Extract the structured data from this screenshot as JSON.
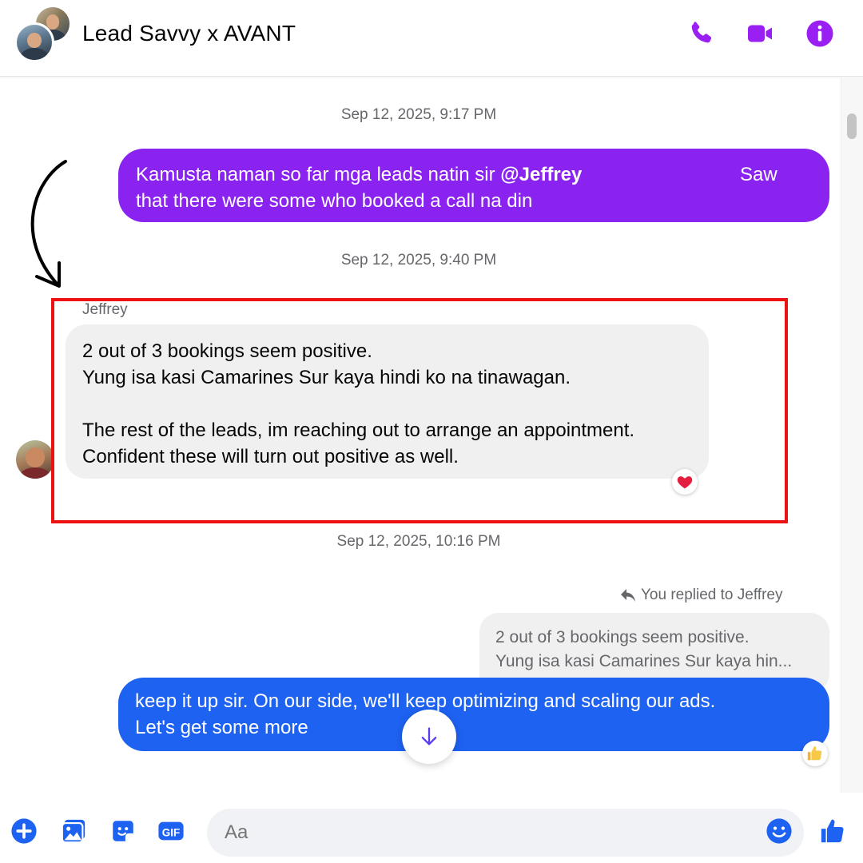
{
  "header": {
    "title": "Lead Savvy x AVANT",
    "icons": [
      "phone-icon",
      "video-icon",
      "info-icon"
    ],
    "accent_color": "#8a22f0"
  },
  "messages": [
    {
      "timestamp": "Sep 12, 2025, 9:17 PM",
      "direction": "outgoing",
      "line1_text": "Kamusta naman so far mga leads natin sir ",
      "mention": "@Jeffrey",
      "line1_tail": "Saw",
      "line2_text": "that there were some who booked a call na din",
      "color": "#8a22f0"
    },
    {
      "timestamp": "Sep 12, 2025, 9:40 PM",
      "direction": "incoming",
      "sender": "Jeffrey",
      "lines": [
        "2 out of 3 bookings seem positive.",
        "Yung isa kasi Camarines Sur kaya hindi ko na tinawagan.",
        "",
        "The rest of the leads, im reaching out to arrange an appointment.",
        "Confident these will turn out positive as well."
      ],
      "reaction": "❤️",
      "color": "#f0f0f0"
    },
    {
      "timestamp": "Sep 12, 2025, 10:16 PM",
      "direction": "outgoing",
      "reply_label": "You replied to Jeffrey",
      "quote_lines": [
        "2 out of 3 bookings seem positive.",
        "Yung isa kasi Camarines Sur kaya hin..."
      ],
      "lines": [
        "keep it up sir. On our side, we'll keep optimizing and scaling our ads.",
        "Let's get some more"
      ],
      "reaction": "👍",
      "color": "#1e62f2"
    }
  ],
  "composer": {
    "placeholder": "Aa",
    "icons": [
      "plus-icon",
      "image-icon",
      "sticker-icon",
      "gif-icon",
      "emoji-icon",
      "like-icon"
    ],
    "gif_label": "GIF"
  },
  "annotation": {
    "highlight_color": "#ee1111"
  }
}
